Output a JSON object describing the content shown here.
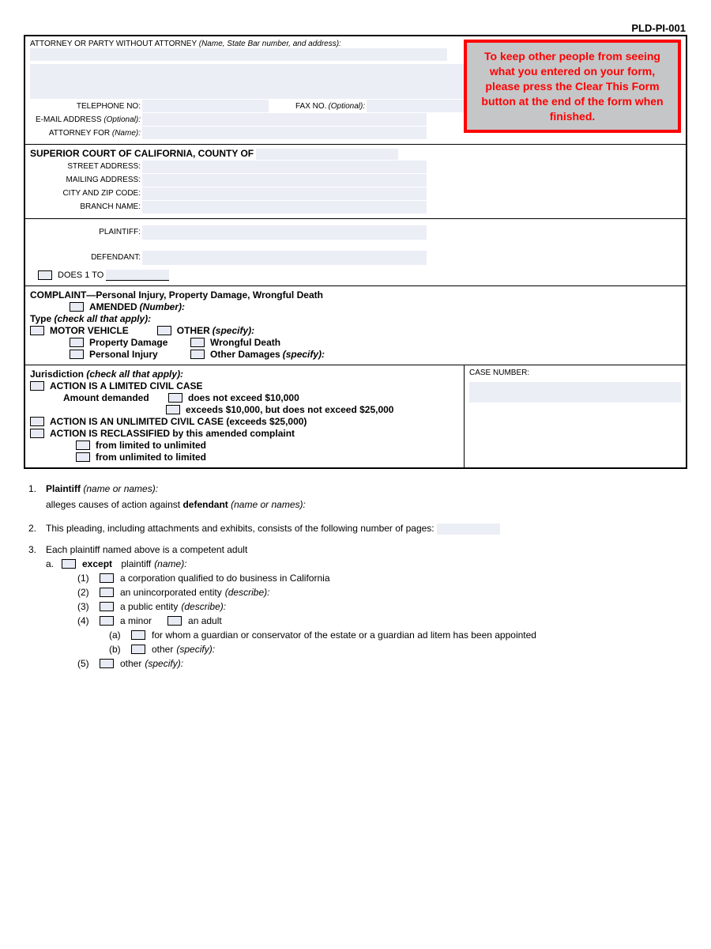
{
  "form_id": "PLD-PI-001",
  "warning": "To keep other people from seeing what you entered on your form, please press the Clear This Form button at the end of the form when finished.",
  "attorney": {
    "header": "ATTORNEY OR PARTY WITHOUT ATTORNEY",
    "header_italic": "(Name, State Bar number, and address):",
    "telephone": "TELEPHONE NO:",
    "fax": "FAX NO.",
    "fax_italic": "(Optional):",
    "email": "E-MAIL ADDRESS",
    "email_italic": "(Optional):",
    "attorney_for": "ATTORNEY FOR",
    "attorney_for_italic": "(Name):"
  },
  "court": {
    "title": "SUPERIOR COURT OF CALIFORNIA, COUNTY OF",
    "street": "STREET ADDRESS:",
    "mailing": "MAILING ADDRESS:",
    "cityzip": "CITY AND ZIP CODE:",
    "branch": "BRANCH NAME:"
  },
  "parties": {
    "plaintiff": "PLAINTIFF:",
    "defendant": "DEFENDANT:",
    "does": "DOES 1 TO"
  },
  "complaint": {
    "title": "COMPLAINT—Personal Injury, Property Damage, Wrongful Death",
    "amended": "AMENDED",
    "amended_italic": "(Number):",
    "type_label": "Type",
    "type_italic": "(check all that apply):",
    "motor_vehicle": "MOTOR VEHICLE",
    "other": "OTHER",
    "other_italic": "(specify):",
    "property_damage": "Property Damage",
    "wrongful_death": "Wrongful Death",
    "personal_injury": "Personal Injury",
    "other_damages": "Other Damages",
    "other_damages_italic": "(specify):"
  },
  "jurisdiction": {
    "title": "Jurisdiction",
    "title_italic": "(check all that apply):",
    "limited": "ACTION IS A LIMITED CIVIL CASE",
    "amount": "Amount demanded",
    "not_exceed_10k": "does not exceed $10,000",
    "exceeds_10k": "exceeds $10,000, but does not exceed $25,000",
    "unlimited": "ACTION IS AN UNLIMITED CIVIL CASE (exceeds $25,000)",
    "reclassified": "ACTION IS RECLASSIFIED by this amended complaint",
    "limited_to_unlimited": "from limited to unlimited",
    "unlimited_to_limited": "from unlimited to limited",
    "case_number": "CASE NUMBER:"
  },
  "items": {
    "i1_a": "Plaintiff",
    "i1_b": "(name or names):",
    "i1_c": "alleges causes of action against",
    "i1_d": "defendant",
    "i1_e": "(name or names):",
    "i2": "This pleading, including attachments and exhibits, consists of the following number of pages:",
    "i3": "Each plaintiff named above is a competent adult",
    "i3a": "except",
    "i3a_italic": "plaintiff",
    "i3a_name": "(name):",
    "i3a1": "a corporation qualified to do business in California",
    "i3a2": "an unincorporated entity",
    "i3a2_italic": "(describe):",
    "i3a3": "a public entity",
    "i3a3_italic": "(describe):",
    "i3a4a": "a minor",
    "i3a4b": "an adult",
    "i3a4_a": "for whom a guardian or conservator of the estate or a guardian ad litem has been appointed",
    "i3a4_b": "other",
    "i3a4_b_italic": "(specify):",
    "i3a5": "other",
    "i3a5_italic": "(specify):"
  }
}
